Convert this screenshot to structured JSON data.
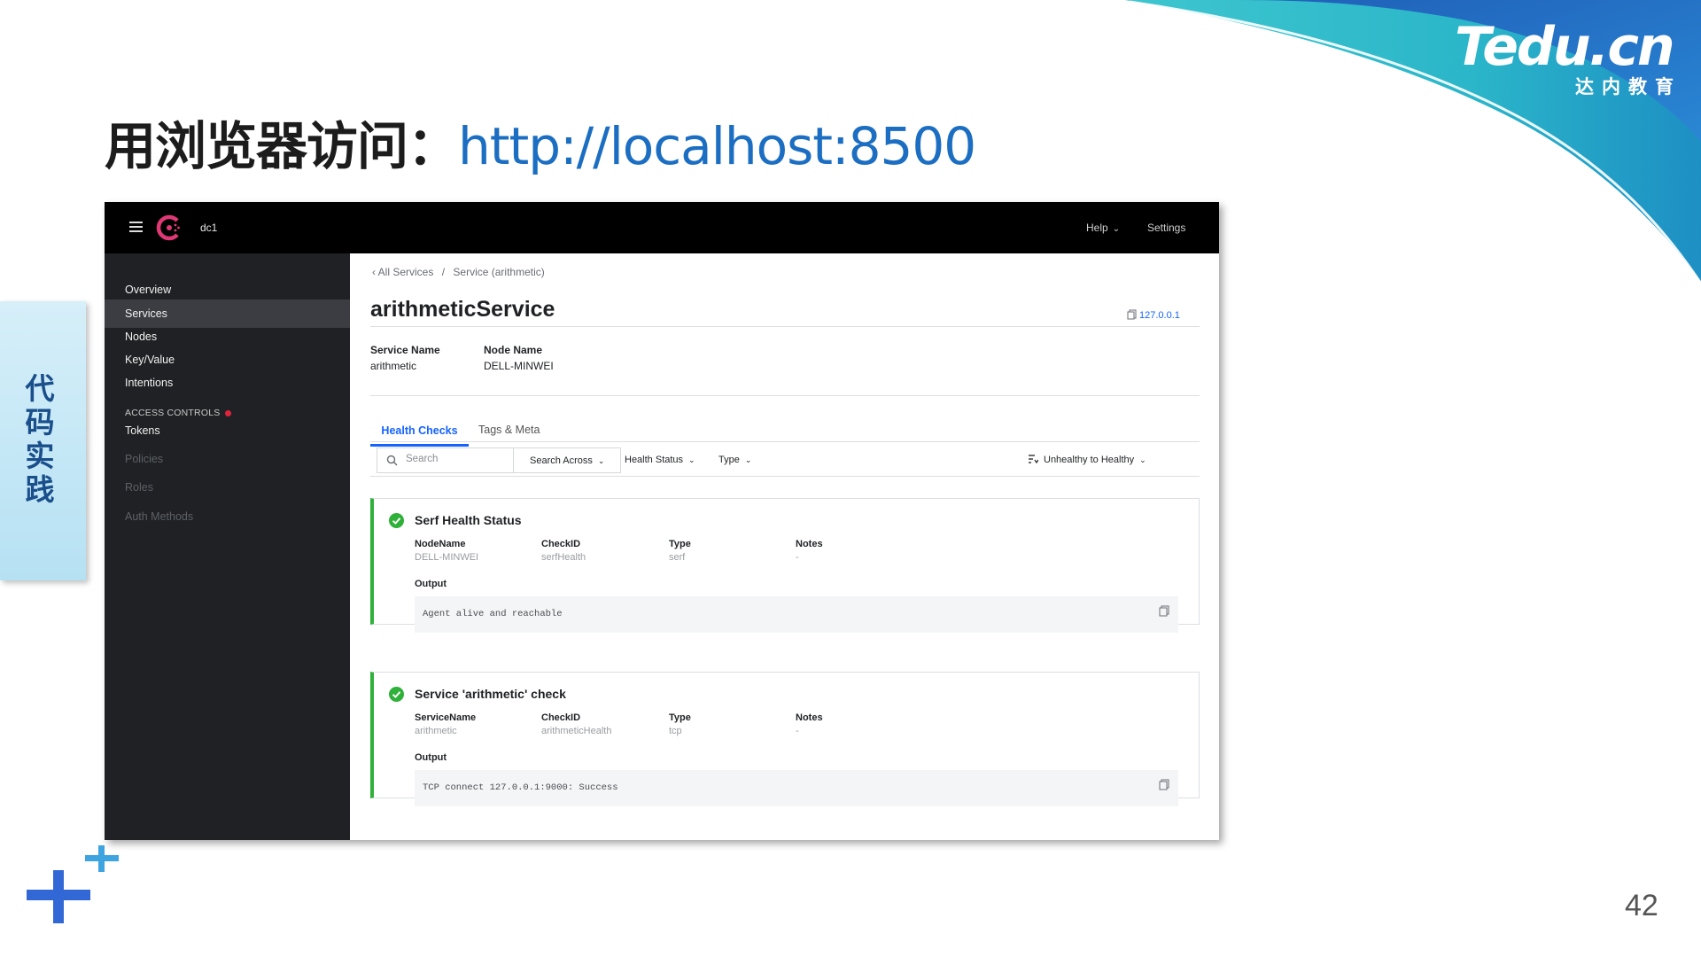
{
  "slide": {
    "title_prefix": "用浏览器访问：",
    "title_url": "http://localhost:8500",
    "logo_main": "Tedu.cn",
    "logo_sub": "达内教育",
    "side_tab_label": "代码实践",
    "page_number": "42"
  },
  "colors": {
    "accent_blue": "#1563ff",
    "status_green": "#2eb039",
    "topbar": "#000000",
    "sidebar": "#1f2124",
    "title_url": "#1b6ec2"
  },
  "consul": {
    "topbar": {
      "datacenter": "dc1",
      "help_label": "Help",
      "settings_label": "Settings"
    },
    "sidebar": {
      "items": [
        {
          "label": "Overview",
          "state": "normal"
        },
        {
          "label": "Services",
          "state": "active"
        },
        {
          "label": "Nodes",
          "state": "normal"
        },
        {
          "label": "Key/Value",
          "state": "normal"
        },
        {
          "label": "Intentions",
          "state": "normal"
        }
      ],
      "access_controls_heading": "ACCESS CONTROLS",
      "access_items": [
        {
          "label": "Tokens",
          "state": "normal"
        },
        {
          "label": "Policies",
          "state": "disabled"
        },
        {
          "label": "Roles",
          "state": "disabled"
        },
        {
          "label": "Auth Methods",
          "state": "disabled"
        }
      ]
    },
    "breadcrumb": {
      "parent": "All Services",
      "separator": "/",
      "current": "Service (arithmetic)"
    },
    "service": {
      "title": "arithmeticService",
      "address": "127.0.0.1",
      "service_name_label": "Service Name",
      "service_name_value": "arithmetic",
      "node_name_label": "Node Name",
      "node_name_value": "DELL-MINWEI"
    },
    "tabs": [
      {
        "label": "Health Checks",
        "active": true
      },
      {
        "label": "Tags & Meta",
        "active": false
      }
    ],
    "filters": {
      "search_placeholder": "Search",
      "search_across": "Search Across",
      "health_status": "Health Status",
      "type": "Type",
      "sort": "Unhealthy to Healthy"
    },
    "checks": [
      {
        "title": "Serf Health Status",
        "columns": [
          {
            "label": "NodeName",
            "value": "DELL-MINWEI"
          },
          {
            "label": "CheckID",
            "value": "serfHealth"
          },
          {
            "label": "Type",
            "value": "serf"
          },
          {
            "label": "Notes",
            "value": "-"
          }
        ],
        "output_label": "Output",
        "output": "Agent alive and reachable"
      },
      {
        "title": "Service 'arithmetic' check",
        "columns": [
          {
            "label": "ServiceName",
            "value": "arithmetic"
          },
          {
            "label": "CheckID",
            "value": "arithmeticHealth"
          },
          {
            "label": "Type",
            "value": "tcp"
          },
          {
            "label": "Notes",
            "value": "-"
          }
        ],
        "output_label": "Output",
        "output": "TCP connect 127.0.0.1:9000: Success"
      }
    ]
  }
}
